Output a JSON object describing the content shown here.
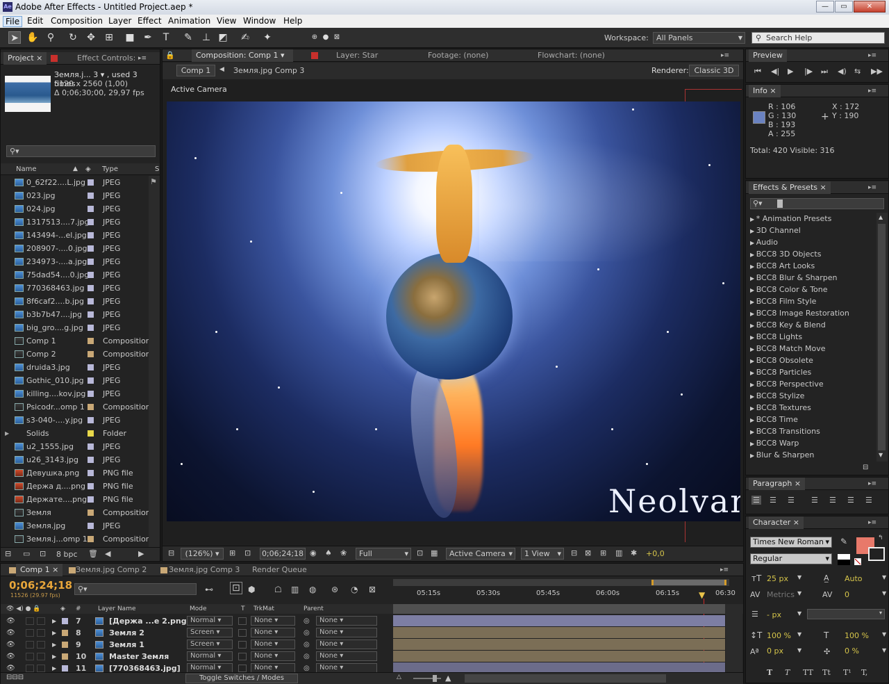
{
  "window": {
    "title": "Adobe After Effects - Untitled Project.aep *",
    "app_badge": "Ae"
  },
  "menu": [
    "File",
    "Edit",
    "Composition",
    "Layer",
    "Effect",
    "Animation",
    "View",
    "Window",
    "Help"
  ],
  "workspace": {
    "label": "Workspace:",
    "value": "All Panels",
    "search_placeholder": "Search Help"
  },
  "project": {
    "tabs": [
      "Project",
      "Effect Controls:"
    ],
    "asset_name": "Земля.j... 3 ▾ , used 3 times",
    "asset_dims": "5120 x 2560 (1,00)",
    "asset_duration": "Δ 0;06;30;00, 29,97 fps",
    "columns": [
      "Name",
      "Type",
      "S"
    ],
    "items": [
      {
        "name": "0_62f22....L.jpg",
        "type": "JPEG",
        "kind": "img",
        "color": "#b8b8d8"
      },
      {
        "name": "023.jpg",
        "type": "JPEG",
        "kind": "img",
        "color": "#b8b8d8"
      },
      {
        "name": "024.jpg",
        "type": "JPEG",
        "kind": "img",
        "color": "#b8b8d8"
      },
      {
        "name": "1317513....7.jpg",
        "type": "JPEG",
        "kind": "img",
        "color": "#b8b8d8"
      },
      {
        "name": "143494-...el.jpg",
        "type": "JPEG",
        "kind": "img",
        "color": "#b8b8d8"
      },
      {
        "name": "208907-....0.jpg",
        "type": "JPEG",
        "kind": "img",
        "color": "#b8b8d8"
      },
      {
        "name": "234973-....a.jpg",
        "type": "JPEG",
        "kind": "img",
        "color": "#b8b8d8"
      },
      {
        "name": "75dad54....0.jpg",
        "type": "JPEG",
        "kind": "img",
        "color": "#b8b8d8"
      },
      {
        "name": "770368463.jpg",
        "type": "JPEG",
        "kind": "img",
        "color": "#b8b8d8"
      },
      {
        "name": "8f6caf2....b.jpg",
        "type": "JPEG",
        "kind": "img",
        "color": "#b8b8d8"
      },
      {
        "name": "b3b7b47....jpg",
        "type": "JPEG",
        "kind": "img",
        "color": "#b8b8d8"
      },
      {
        "name": "big_gro....g.jpg",
        "type": "JPEG",
        "kind": "img",
        "color": "#b8b8d8"
      },
      {
        "name": "Comp 1",
        "type": "Composition",
        "kind": "comp",
        "color": "#c9a876"
      },
      {
        "name": "Comp 2",
        "type": "Composition",
        "kind": "comp",
        "color": "#c9a876"
      },
      {
        "name": "druida3.jpg",
        "type": "JPEG",
        "kind": "img",
        "color": "#b8b8d8"
      },
      {
        "name": "Gothic_010.jpg",
        "type": "JPEG",
        "kind": "img",
        "color": "#b8b8d8"
      },
      {
        "name": "killing....kov.jpg",
        "type": "JPEG",
        "kind": "img",
        "color": "#b8b8d8"
      },
      {
        "name": "Psicodr...omp 1",
        "type": "Composition",
        "kind": "comp",
        "color": "#c9a876"
      },
      {
        "name": "s3-040-....y.jpg",
        "type": "JPEG",
        "kind": "img",
        "color": "#b8b8d8"
      },
      {
        "name": "Solids",
        "type": "Folder",
        "kind": "folder",
        "color": "#e8d84a"
      },
      {
        "name": "u2_1555.jpg",
        "type": "JPEG",
        "kind": "img",
        "color": "#b8b8d8"
      },
      {
        "name": "u26_3143.jpg",
        "type": "JPEG",
        "kind": "img",
        "color": "#b8b8d8"
      },
      {
        "name": "Девушка.png",
        "type": "PNG file",
        "kind": "png",
        "color": "#b8b8d8"
      },
      {
        "name": "Держа д....png",
        "type": "PNG file",
        "kind": "png",
        "color": "#b8b8d8"
      },
      {
        "name": "Держате....png",
        "type": "PNG file",
        "kind": "png",
        "color": "#b8b8d8"
      },
      {
        "name": "Земля",
        "type": "Composition",
        "kind": "comp",
        "color": "#c9a876"
      },
      {
        "name": "Земля.jpg",
        "type": "JPEG",
        "kind": "img",
        "color": "#b8b8d8"
      },
      {
        "name": "Земля.j...omp 1",
        "type": "Composition",
        "kind": "comp",
        "color": "#c9a876"
      }
    ],
    "bpc": "8 bpc"
  },
  "composition": {
    "tabs": [
      "Composition: Comp 1",
      "Layer: Star",
      "Footage: (none)",
      "Flowchart: (none)"
    ],
    "breadcrumb": [
      "Comp 1",
      "Земля.jpg Comp 3"
    ],
    "renderer_label": "Renderer:",
    "renderer_value": "Classic 3D",
    "view_label": "Active Camera",
    "watermark": "Neolvan",
    "footer": {
      "zoom": "(126%)",
      "timecode": "0;06;24;18",
      "resolution": "Full",
      "camera": "Active Camera",
      "views": "1 View",
      "exposure": "+0,0"
    }
  },
  "preview": {
    "title": "Preview"
  },
  "info": {
    "title": "Info",
    "r": "R : 106",
    "g": "G : 130",
    "b": "B : 193",
    "a": "A : 255",
    "x": "X : 172",
    "y": "Y : 190",
    "totals": "Total: 420  Visible: 316",
    "swatch": "#6a82c1"
  },
  "effects": {
    "title": "Effects & Presets",
    "items": [
      "* Animation Presets",
      "3D Channel",
      "Audio",
      "BCC8 3D Objects",
      "BCC8 Art Looks",
      "BCC8 Blur & Sharpen",
      "BCC8 Color & Tone",
      "BCC8 Film Style",
      "BCC8 Image Restoration",
      "BCC8 Key & Blend",
      "BCC8 Lights",
      "BCC8 Match Move",
      "BCC8 Obsolete",
      "BCC8 Particles",
      "BCC8 Perspective",
      "BCC8 Stylize",
      "BCC8 Textures",
      "BCC8 Time",
      "BCC8 Transitions",
      "BCC8 Warp",
      "Blur & Sharpen"
    ]
  },
  "paragraph": {
    "title": "Paragraph"
  },
  "character": {
    "title": "Character",
    "font": "Times New Roman",
    "style": "Regular",
    "size": "25 px",
    "leading": "Auto",
    "kerning": "Metrics",
    "tracking": "0",
    "stroke": "- px",
    "vscale": "100 %",
    "hscale": "100 %",
    "baseline": "0 px",
    "tsume": "0 %",
    "fill_color": "#e8796a",
    "styles": [
      "T",
      "T",
      "TT",
      "Tt",
      "T¹",
      "T,"
    ]
  },
  "timeline": {
    "tabs": [
      "Comp 1",
      "Земля.jpg Comp 2",
      "Земля.jpg Comp 3",
      "Render Queue"
    ],
    "timecode": "0;06;24;18",
    "frames": "11526 (29.97 fps)",
    "ruler": [
      "05:15s",
      "05:30s",
      "05:45s",
      "06:00s",
      "06:15s",
      "06:30"
    ],
    "columns": {
      "num": "#",
      "name": "Layer Name",
      "mode": "Mode",
      "t": "T",
      "trkmat": "TrkMat",
      "parent": "Parent"
    },
    "layers": [
      {
        "num": "7",
        "name": "[Держа ...e 2.png]",
        "mode": "Normal",
        "trkmat": "None",
        "parent": "None",
        "color": "#b8b8d8",
        "bar": "#7d7ea3"
      },
      {
        "num": "8",
        "name": "Земля 2",
        "mode": "Screen",
        "trkmat": "None",
        "parent": "None",
        "color": "#c9a876",
        "bar": "#7b6e56"
      },
      {
        "num": "9",
        "name": "Земля 1",
        "mode": "Screen",
        "trkmat": "None",
        "parent": "None",
        "color": "#c9a876",
        "bar": "#7b6e56"
      },
      {
        "num": "10",
        "name": "Master Земля",
        "mode": "Normal",
        "trkmat": "None",
        "parent": "None",
        "color": "#c9a876",
        "bar": "#7b6e56"
      },
      {
        "num": "11",
        "name": "[770368463.jpg]",
        "mode": "Normal",
        "trkmat": "None",
        "parent": "None",
        "color": "#b8b8d8",
        "bar": "#6c6c8a"
      }
    ],
    "toggle_label": "Toggle Switches / Modes"
  }
}
